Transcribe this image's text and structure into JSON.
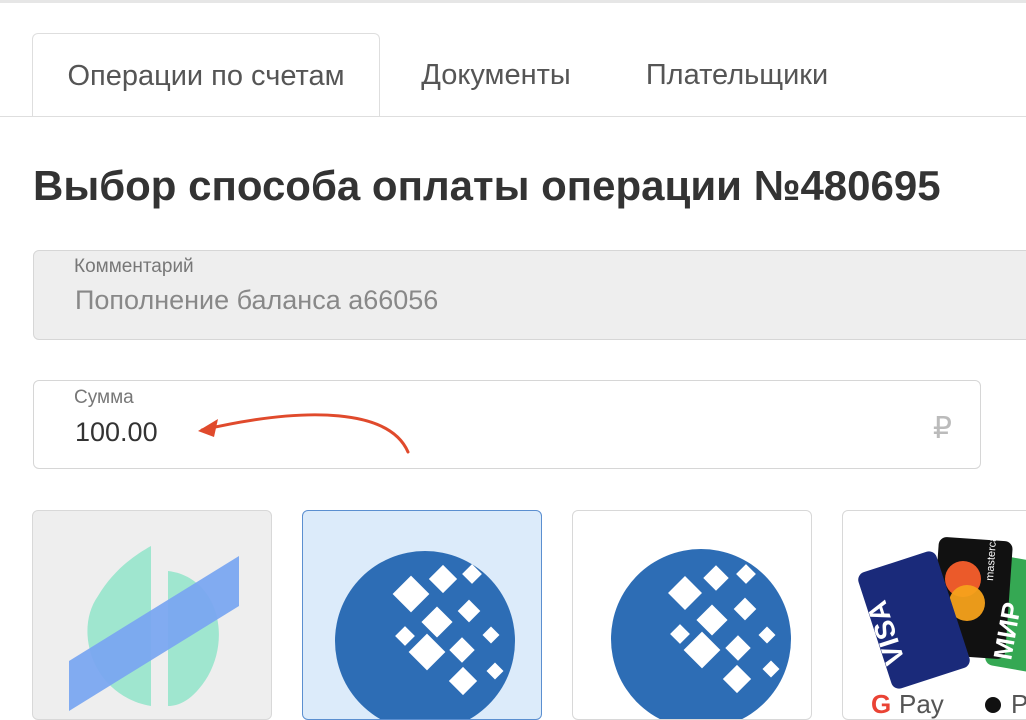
{
  "tabs": [
    {
      "label": "Операции по счетам",
      "active": true
    },
    {
      "label": "Документы",
      "active": false
    },
    {
      "label": "Плательщики",
      "active": false
    }
  ],
  "page": {
    "title": "Выбор способа оплаты операции №480695"
  },
  "comment_field": {
    "label": "Комментарий",
    "value": "Пополнение баланса a66056"
  },
  "amount_field": {
    "label": "Сумма",
    "value": "100.00",
    "currency": "₽"
  },
  "payment_methods": [
    {
      "icon": "green-blue-logo-icon",
      "selected": false
    },
    {
      "icon": "webmoney-icon",
      "selected": true
    },
    {
      "icon": "webmoney-icon",
      "selected": false
    },
    {
      "icon": "bank-cards-icon",
      "selected": false,
      "text": {
        "visa": "VISA",
        "mastercard": "mastercard",
        "mir": "МИР",
        "gpay": "Pay"
      }
    }
  ],
  "colors": {
    "accent_selected": "#dcebfa",
    "arrow": "#e04a2c",
    "webmoney_blue": "#2d6db5"
  }
}
